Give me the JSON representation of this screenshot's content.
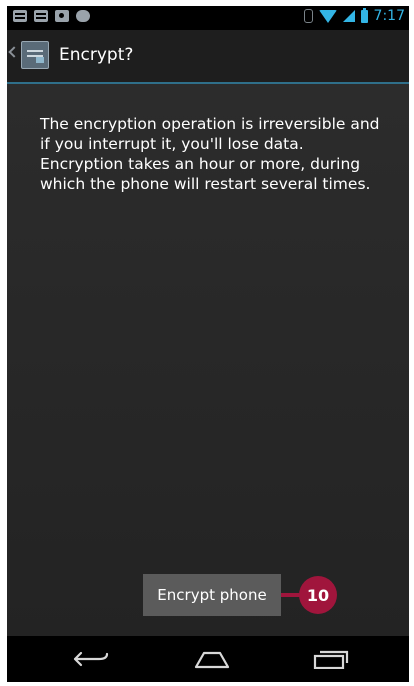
{
  "status_bar": {
    "time": "7:17",
    "notification_icons": [
      "message-icon",
      "chat-icon",
      "camera-icon",
      "gamepad-icon"
    ],
    "system_icons": [
      "bluetooth-icon",
      "wifi-icon",
      "signal-icon",
      "battery-icon"
    ],
    "accent_color": "#33b5e5"
  },
  "action_bar": {
    "title": "Encrypt?",
    "icon": "encrypt-settings-icon"
  },
  "message": "The encryption operation is irreversible and if you interrupt it, you'll lose data. Encryption takes an hour or more, during which the phone will restart several times.",
  "encrypt_button": {
    "label": "Encrypt phone"
  },
  "callout": {
    "label": "10",
    "color": "#a0153c"
  },
  "nav_bar": {
    "icons": [
      "back-icon",
      "home-icon",
      "recent-apps-icon"
    ]
  }
}
